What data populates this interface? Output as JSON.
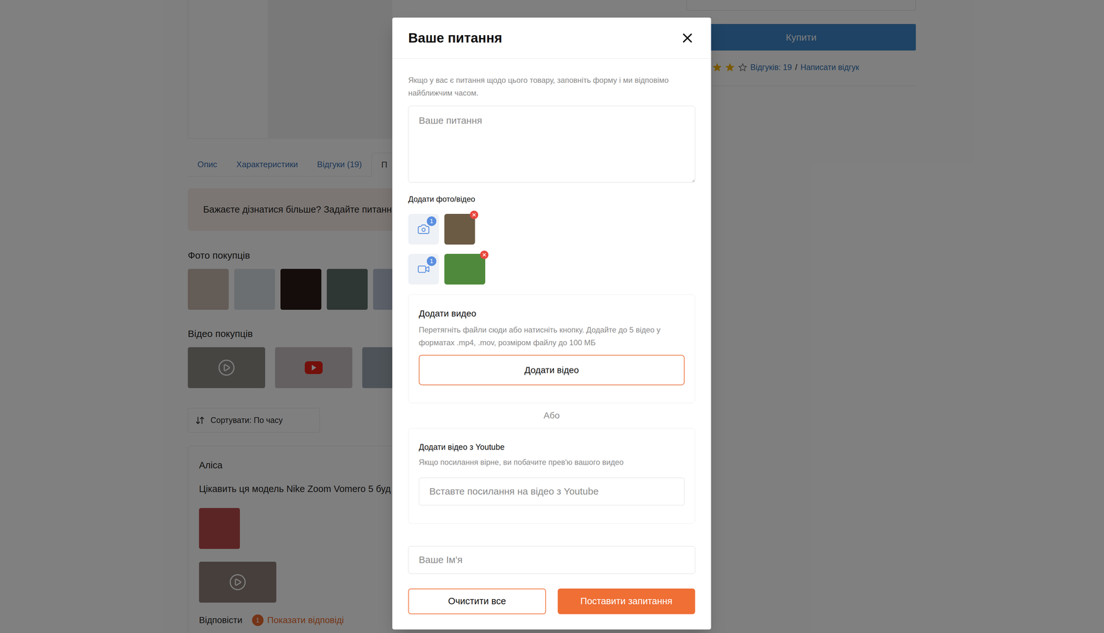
{
  "page": {
    "buy_button": "Купити",
    "rating": {
      "stars": 2,
      "reviews_link": "Відгуків: 19",
      "separator": "/",
      "write_review": "Написати відгук"
    },
    "tabs": [
      {
        "label": "Опис",
        "selected": false
      },
      {
        "label": "Характеристики",
        "selected": false
      },
      {
        "label": "Відгуки (19)",
        "selected": false
      },
      {
        "label": "П",
        "selected": true
      }
    ],
    "banner": "Бажаєте дізнатися більше? Задайте питанн",
    "photos": {
      "title": "Фото покупців",
      "items": [
        {
          "color": "#c9b9ae"
        },
        {
          "color": "#d9dee4"
        },
        {
          "color": "#2b1a17"
        },
        {
          "color": "#5e6e6a"
        },
        {
          "color": "#b9c1d2"
        }
      ]
    },
    "videos": {
      "title": "Відео покупців",
      "items": [
        {
          "kind": "video",
          "color": "#8f8a85"
        },
        {
          "kind": "youtube",
          "color": "#c9c0c2"
        },
        {
          "kind": "video",
          "color": "#9ca6b3"
        }
      ]
    },
    "sort": "Сортувати: По часу",
    "question": {
      "author": "Аліса",
      "text": "Цікавить ця модель Nike Zoom Vomero 5 буд",
      "photo_color": "#b84a4a",
      "video_color": "#8c7f78",
      "reply": "Відповісти",
      "replies_count": "1",
      "show_replies": "Показати відповіді"
    }
  },
  "dialog": {
    "title": "Ваше питання",
    "intro": "Якщо у вас є питання щодо цього товару, заповніть форму і ми відповімо найближчим часом.",
    "question_placeholder": "Ваше питання",
    "media_label": "Додати фото/відео",
    "attachments": [
      {
        "kind": "photo",
        "count": "1",
        "color": "#6b5a44"
      },
      {
        "kind": "video",
        "count": "1",
        "color": "#4f8a3c"
      }
    ],
    "upload": {
      "title": "Додати видео",
      "hint": "Перетягніть файли сюди або натисніть кнопку. Додайте до 5 відео у форматах .mp4, .mov, розміром файлу до 100 МБ",
      "button": "Додати відео"
    },
    "or": "Або",
    "youtube": {
      "title": "Додати відео з Youtube",
      "hint": "Якщо посилання вірне, ви побачите прев'ю вашого видео",
      "placeholder": "Вставте посилання на відео з Youtube"
    },
    "name_placeholder": "Ваше Ім'я",
    "buttons": [
      {
        "label": "Очистити все",
        "kind": "secondary"
      },
      {
        "label": "Поставити запитання",
        "kind": "primary"
      }
    ]
  }
}
